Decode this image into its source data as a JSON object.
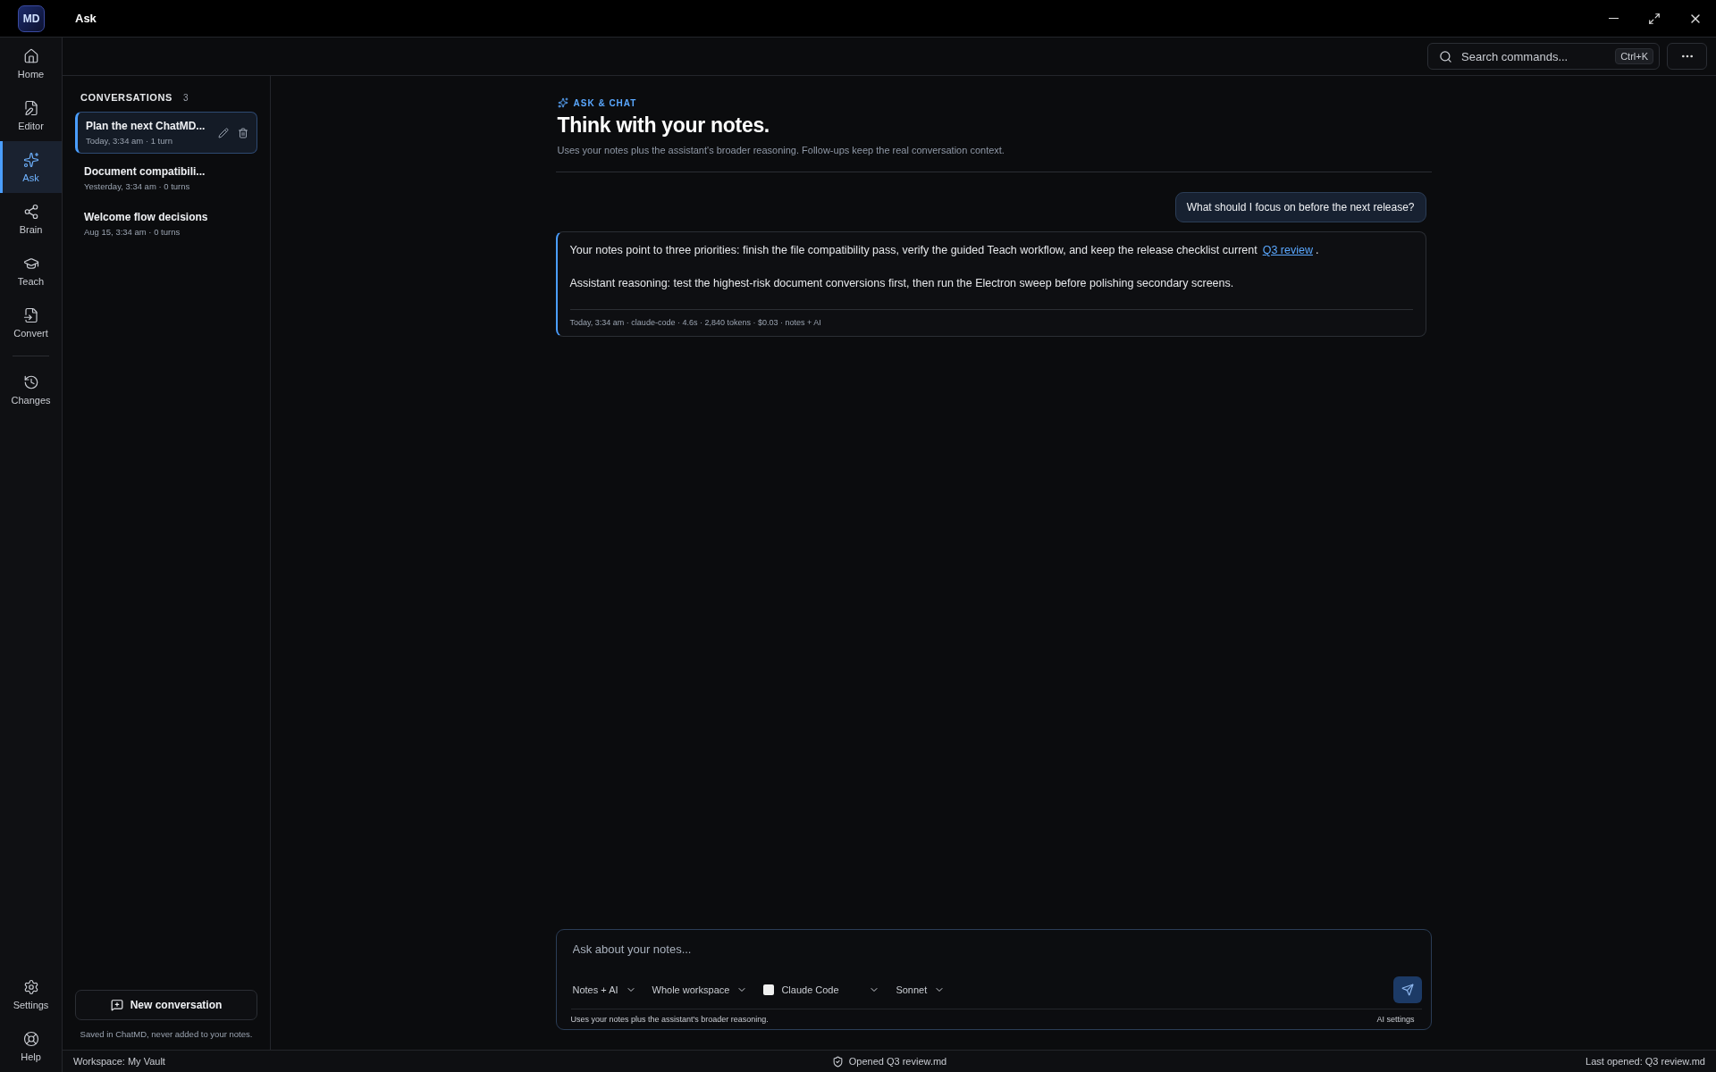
{
  "app": {
    "logo": "MD",
    "title": "Ask"
  },
  "nav": {
    "items": [
      {
        "label": "Home",
        "kind": "home",
        "selected": false
      },
      {
        "label": "Editor",
        "kind": "editor",
        "selected": false
      },
      {
        "label": "Ask",
        "kind": "ask",
        "selected": true
      },
      {
        "label": "Brain",
        "kind": "brain",
        "selected": false
      },
      {
        "label": "Teach",
        "kind": "teach",
        "selected": false
      },
      {
        "label": "Convert",
        "kind": "convert",
        "selected": false
      },
      {
        "label": "Changes",
        "kind": "changes",
        "selected": false
      }
    ],
    "footer": [
      {
        "label": "Settings",
        "kind": "settings",
        "selected": false
      },
      {
        "label": "Help",
        "kind": "help",
        "selected": false
      }
    ]
  },
  "search": {
    "placeholder": "Search commands...",
    "shortcut": "Ctrl+K"
  },
  "conversations": {
    "title": "CONVERSATIONS",
    "count": "3",
    "items": [
      {
        "title": "Plan the next ChatMD...",
        "meta": "Today, 3:34 am · 1 turn",
        "selected": true
      },
      {
        "title": "Document compatibili...",
        "meta": "Yesterday, 3:34 am · 0 turns",
        "selected": false
      },
      {
        "title": "Welcome flow decisions",
        "meta": "Aug 15, 3:34 am · 0 turns",
        "selected": false
      }
    ],
    "new_button": "New conversation",
    "note": "Saved in ChatMD, never added to your notes."
  },
  "header": {
    "eyebrow": "ASK & CHAT",
    "title": "Think with your notes.",
    "subtitle": "Uses your notes plus the assistant's broader reasoning. Follow-ups keep the real conversation context."
  },
  "messages": [
    {
      "kind": "user",
      "text": "What should I focus on before the next release?"
    },
    {
      "kind": "assistant",
      "paragraphs": [
        {
          "text": "Your notes point to three priorities: finish the file compatibility pass, verify the guided Teach workflow, and keep the release checklist current",
          "link": "Q3 review",
          "after": "."
        },
        {
          "text": "Assistant reasoning: test the highest-risk document conversions first, then run the Electron sweep before polishing secondary screens."
        }
      ],
      "meta": "Today, 3:34 am · claude-code · 4.6s · 2,840 tokens · $0.03 · notes + AI"
    }
  ],
  "composer": {
    "placeholder": "Ask about your notes...",
    "selectors": [
      {
        "label": "Notes + AI",
        "kind": "plain"
      },
      {
        "label": "Whole workspace",
        "kind": "plain"
      },
      {
        "label": "Claude Code",
        "kind": "provider"
      },
      {
        "label": "Sonnet",
        "kind": "plain"
      }
    ],
    "hint": "Uses your notes plus the assistant's broader reasoning.",
    "settings_link": "AI settings"
  },
  "status_bar": {
    "left": "Workspace: My Vault",
    "center": "Opened Q3 review.md",
    "right": "Last opened: Q3 review.md"
  }
}
